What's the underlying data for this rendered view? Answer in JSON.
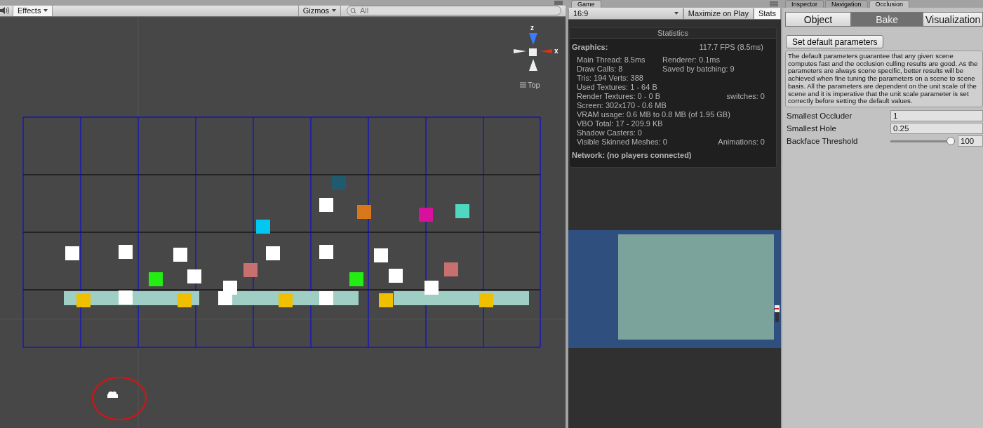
{
  "scene": {
    "toolbar": {
      "effects": {
        "label": "Effects",
        "on": true
      },
      "gizmos": {
        "label": "Gizmos"
      },
      "search": {
        "placeholder": "All"
      }
    },
    "gizmo": {
      "axes": [
        {
          "label": "z"
        },
        {
          "label": "x"
        }
      ],
      "view_label": "Top"
    }
  },
  "game": {
    "tabs": [
      {
        "label": "Game",
        "selected": true
      }
    ],
    "toolbar": {
      "aspect": "16:9",
      "toggles": [
        {
          "label": "Maximize on Play",
          "on": false
        },
        {
          "label": "Stats",
          "on": true
        }
      ]
    },
    "statistics": {
      "title": "Statistics",
      "graphics": {
        "label": "Graphics:",
        "fps": "117.7 FPS (8.5ms)"
      },
      "rows": [
        {
          "left": "Main Thread: 8.5ms",
          "right": "Renderer: 0.1ms"
        },
        {
          "left": "Draw Calls: 8",
          "right": "Saved by batching: 9"
        },
        {
          "left": "Tris: 194 Verts: 388"
        },
        {
          "left": "Used Textures: 1 - 64 B"
        },
        {
          "left": "Render Textures: 0 - 0 B",
          "right": "switches: 0"
        },
        {
          "left": "Screen: 302x170 - 0.6 MB"
        },
        {
          "left": "VRAM usage: 0.6 MB to 0.8 MB (of 1.95 GB)"
        },
        {
          "left": "VBO Total: 17 - 209.9 KB"
        },
        {
          "left": "Shadow Casters: 0"
        },
        {
          "left": "Visible Skinned Meshes: 0",
          "right": "Animations: 0"
        }
      ],
      "network": "Network: (no players connected)"
    }
  },
  "inspector": {
    "tabs": [
      {
        "label": "Inspector",
        "selected": false
      },
      {
        "label": "Navigation",
        "selected": false
      },
      {
        "label": "Occlusion",
        "selected": true
      }
    ],
    "modes": [
      {
        "label": "Object",
        "selected": false
      },
      {
        "label": "Bake",
        "selected": true
      },
      {
        "label": "Visualization",
        "selected": false
      }
    ],
    "button": "Set default parameters",
    "help": "The default parameters guarantee that any given scene computes fast and the occlusion culling results are good. As the parameters are always scene specific, better results will be achieved when fine tuning the parameters on a scene to scene basis. All the parameters are dependent on the unit scale of the scene and it is imperative that the unit scale parameter is set correctly before setting the default values.",
    "fields": [
      {
        "kind": "text",
        "label": "Smallest Occluder",
        "value": "1"
      },
      {
        "kind": "text",
        "label": "Smallest Hole",
        "value": "0.25"
      },
      {
        "kind": "slider",
        "label": "Backface Threshold",
        "value": "100",
        "level": 1
      }
    ]
  }
}
